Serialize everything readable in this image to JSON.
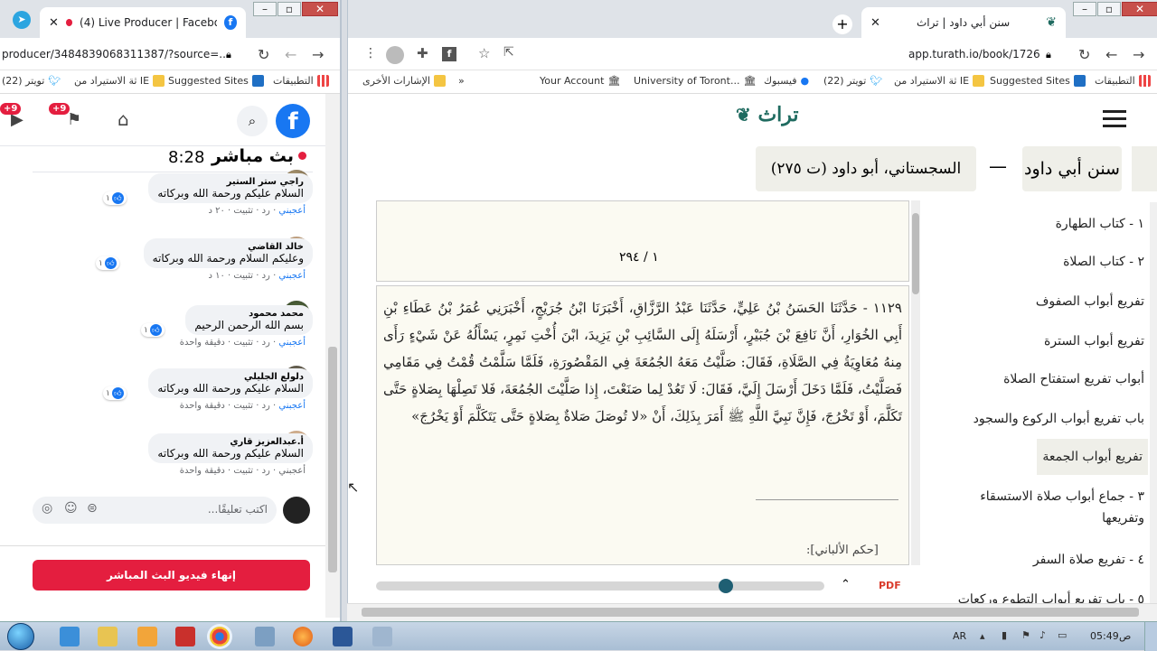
{
  "left_window": {
    "tab_title": "(4) Live Producer | Facebook",
    "url": "producer/3484839068311387/?source=...",
    "bookmarks": [
      "(22) تويتر",
      "ثة الاستيراد من IE",
      "Suggested Sites",
      "التطبيقات"
    ],
    "header_badges": [
      "+9",
      "+9"
    ],
    "live_title": "بث مباشر",
    "live_time": "8:28",
    "comments": [
      {
        "name": "راجي ستر الستير",
        "text": "السلام عليكم ورحمة الله وبركاته",
        "meta_like": "أعجبني",
        "meta_rest": " · رد · تثبيت · ٢٠ د",
        "likes": "١"
      },
      {
        "name": "خالد القاضي",
        "text": "وعليكم السلام ورحمة الله وبركاته",
        "meta_like": "أعجبني",
        "meta_rest": " · رد · تثبيت · ١٠ د",
        "likes": "١"
      },
      {
        "name": "محمد محمود",
        "text": "بسم الله الرحمن الرحيم",
        "meta_like": "أعجبني",
        "meta_rest": " · رد · تثبيت · دقيقة واحدة",
        "likes": "١"
      },
      {
        "name": "دلولع الجليلي",
        "text": "السلام عليكم ورحمة الله وبركاته",
        "meta_like": "أعجبني",
        "meta_rest": " · رد · تثبيت · دقيقة واحدة",
        "likes": "١"
      },
      {
        "name": "أ.عبدالعزيز قاري",
        "text": "السلام عليكم ورحمة الله وبركاته",
        "meta_like": "أعجبني",
        "meta_rest": " · رد · تثبيت · دقيقة واحدة",
        "likes": ""
      }
    ],
    "comment_placeholder": "اكتب تعليقًا...",
    "end_button": "إنهاء فيديو البث المباشر"
  },
  "right_window": {
    "tab_title": "سنن أبي داود | تراث",
    "url": "app.turath.io/book/1726",
    "bookmarks": [
      "Your Account",
      "University of Toront...",
      "فيسبوك",
      "(22) تويتر",
      "ثة الاستيراد من IE",
      "Suggested Sites",
      "التطبيقات",
      "الإشارات الأخرى",
      "»"
    ],
    "brand": "تراث",
    "book_title": "سنن أبي داود",
    "dash": "—",
    "author": "السجستاني، أبو داود (ت ٢٧٥)",
    "page_number": "١ / ٢٩٤",
    "hadith_text": "١١٢٩ - حَدَّثَنَا الحَسَنُ بْنُ عَلِيٍّ، حَدَّثَنَا عَبْدُ الرَّزَّاقِ، أَخْبَرَنَا ابْنُ جُرَيْجٍ، أَخْبَرَنِي عُمَرُ بْنُ عَطَاءِ بْنِ أَبِي الخُوَارِ، أَنَّ نَافِعَ بْنَ جُبَيْرٍ، أَرْسَلَهُ إِلَى السَّائِبِ بْنِ يَزِيدَ، ابْنَ أُخْتِ نَمِرٍ، يَسْأَلُهُ عَنْ شَيْءٍ رَأَى مِنهُ مُعَاوِيَةُ فِي الصَّلَاةِ، فَقَالَ: صَلَّيْتُ مَعَهُ الجُمُعَةَ فِي المَقْصُورَةِ، فَلَمَّا سَلَّمْتُ قُمْتُ فِي مَقَامِي فَصَلَّيْتُ، فَلَمَّا دَخَلَ أَرْسَلَ إِلَيَّ، فَقَالَ: لَا تَعُدْ لِما صَنَعْتَ، إِذا صَلَّيْتَ الجُمُعَةَ، فَلا تَصِلْهَا بِصَلاةٍ حَتَّى تَكَلَّمَ، أَوْ تَخْرُجَ، فَإِنَّ نَبِيَّ اللَّهِ ﷺ أَمَرَ بِذَلِكَ، أَنْ «لا تُوصَلَ صَلاةٌ بِصَلاةٍ حَتَّى يَتَكَلَّمَ أَوْ يَخْرُجَ»",
    "grade_label": "[حكم الألباني]:",
    "pdf_label": "PDF",
    "slider_position": 0.78,
    "toc": [
      {
        "label": "١ - كتاب الطهارة",
        "selected": false
      },
      {
        "label": "٢ - كتاب الصلاة",
        "selected": false
      },
      {
        "label": "تفريع أبواب الصفوف",
        "selected": false
      },
      {
        "label": "تفريع أبواب السترة",
        "selected": false
      },
      {
        "label": "أبواب تفريع استفتاح الصلاة",
        "selected": false
      },
      {
        "label": "باب تفريع أبواب الركوع والسجود",
        "selected": false
      },
      {
        "label": "تفريع أبواب الجمعة",
        "selected": true
      },
      {
        "label": "٣ - جماع أبواب صلاة الاستسقاء وتفريعها",
        "selected": false
      },
      {
        "label": "٤ - تفريع صلاة السفر",
        "selected": false
      },
      {
        "label": "٥ - باب تفريع أبواب التطوع وركعات",
        "selected": false
      }
    ]
  },
  "taskbar": {
    "lang": "AR",
    "time": "05:49",
    "ampm": "ص"
  }
}
